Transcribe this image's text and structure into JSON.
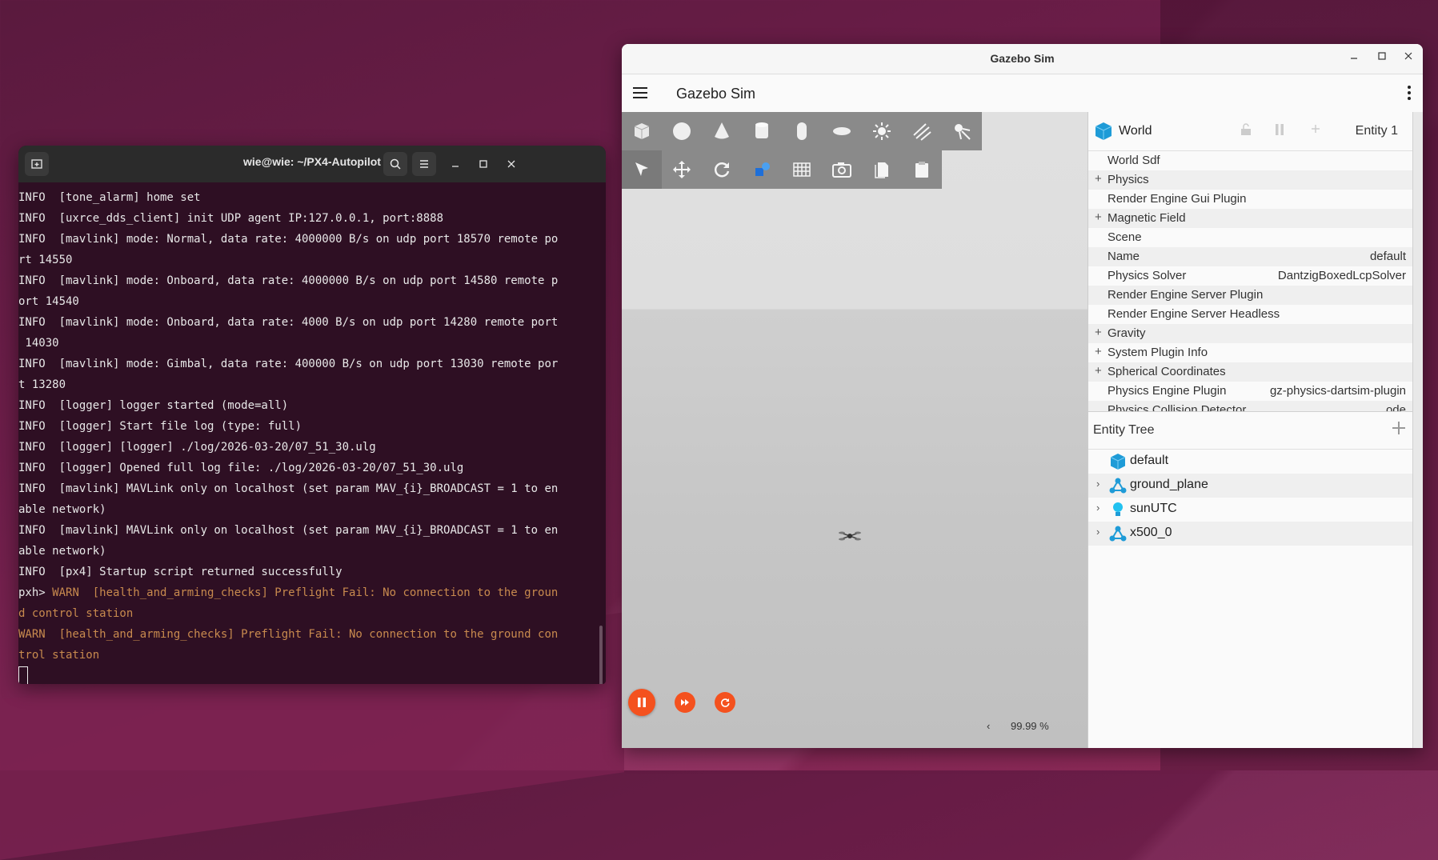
{
  "terminal": {
    "title": "wie@wie: ~/PX4-Autopilot",
    "lines": [
      {
        "text": "INFO  [tone_alarm] home set",
        "warn": ""
      },
      {
        "text": "INFO  [uxrce_dds_client] init UDP agent IP:127.0.0.1, port:8888",
        "warn": ""
      },
      {
        "text": "INFO  [mavlink] mode: Normal, data rate: 4000000 B/s on udp port 18570 remote po",
        "warn": ""
      },
      {
        "text": "rt 14550",
        "warn": ""
      },
      {
        "text": "INFO  [mavlink] mode: Onboard, data rate: 4000000 B/s on udp port 14580 remote p",
        "warn": ""
      },
      {
        "text": "ort 14540",
        "warn": ""
      },
      {
        "text": "INFO  [mavlink] mode: Onboard, data rate: 4000 B/s on udp port 14280 remote port",
        "warn": ""
      },
      {
        "text": " 14030",
        "warn": ""
      },
      {
        "text": "INFO  [mavlink] mode: Gimbal, data rate: 400000 B/s on udp port 13030 remote por",
        "warn": ""
      },
      {
        "text": "t 13280",
        "warn": ""
      },
      {
        "text": "INFO  [logger] logger started (mode=all)",
        "warn": ""
      },
      {
        "text": "INFO  [logger] Start file log (type: full)",
        "warn": ""
      },
      {
        "text": "INFO  [logger] [logger] ./log/2026-03-20/07_51_30.ulg",
        "warn": ""
      },
      {
        "text": "INFO  [logger] Opened full log file: ./log/2026-03-20/07_51_30.ulg",
        "warn": ""
      },
      {
        "text": "INFO  [mavlink] MAVLink only on localhost (set param MAV_{i}_BROADCAST = 1 to en",
        "warn": ""
      },
      {
        "text": "able network)",
        "warn": ""
      },
      {
        "text": "INFO  [mavlink] MAVLink only on localhost (set param MAV_{i}_BROADCAST = 1 to en",
        "warn": ""
      },
      {
        "text": "able network)",
        "warn": ""
      },
      {
        "text": "INFO  [px4] Startup script returned successfully",
        "warn": ""
      },
      {
        "text": "pxh> ",
        "warn": "WARN  [health_and_arming_checks] Preflight Fail: No connection to the groun"
      },
      {
        "text": "",
        "warn": "d control station"
      },
      {
        "text": "",
        "warn": "WARN  [health_and_arming_checks] Preflight Fail: No connection to the ground con"
      },
      {
        "text": "",
        "warn": "trol station"
      }
    ]
  },
  "gazebo": {
    "window_title": "Gazebo Sim",
    "app_title": "Gazebo Sim",
    "component_inspector": {
      "entity_name": "World",
      "entity_id": "Entity 1",
      "properties": [
        {
          "plus": "",
          "name": "World Sdf",
          "value": ""
        },
        {
          "plus": "+",
          "name": "Physics",
          "value": ""
        },
        {
          "plus": "",
          "name": "Render Engine Gui Plugin",
          "value": ""
        },
        {
          "plus": "+",
          "name": "Magnetic Field",
          "value": ""
        },
        {
          "plus": "",
          "name": "Scene",
          "value": ""
        },
        {
          "plus": "",
          "name": "Name",
          "value": "default"
        },
        {
          "plus": "",
          "name": "Physics Solver",
          "value": "DantzigBoxedLcpSolver"
        },
        {
          "plus": "",
          "name": "Render Engine Server Plugin",
          "value": ""
        },
        {
          "plus": "",
          "name": "Render Engine Server Headless",
          "value": ""
        },
        {
          "plus": "+",
          "name": "Gravity",
          "value": ""
        },
        {
          "plus": "+",
          "name": "System Plugin Info",
          "value": ""
        },
        {
          "plus": "+",
          "name": "Spherical Coordinates",
          "value": ""
        },
        {
          "plus": "",
          "name": "Physics Engine Plugin",
          "value": "gz-physics-dartsim-plugin"
        },
        {
          "plus": "",
          "name": "Physics Collision Detector",
          "value": "ode"
        }
      ]
    },
    "entity_tree": {
      "title": "Entity Tree",
      "items": [
        {
          "label": "default",
          "chevron": "",
          "icon": "cube-icon"
        },
        {
          "label": "ground_plane",
          "chevron": "›",
          "icon": "model-icon"
        },
        {
          "label": "sunUTC",
          "chevron": "›",
          "icon": "light-icon"
        },
        {
          "label": "x500_0",
          "chevron": "›",
          "icon": "model-icon"
        }
      ]
    },
    "rtf": "99.99 %",
    "rtf_arrow": "‹",
    "colors": {
      "accent": "#f4511e",
      "toolbar": "#8a8a8a",
      "cube": "#1e9bd7"
    }
  }
}
